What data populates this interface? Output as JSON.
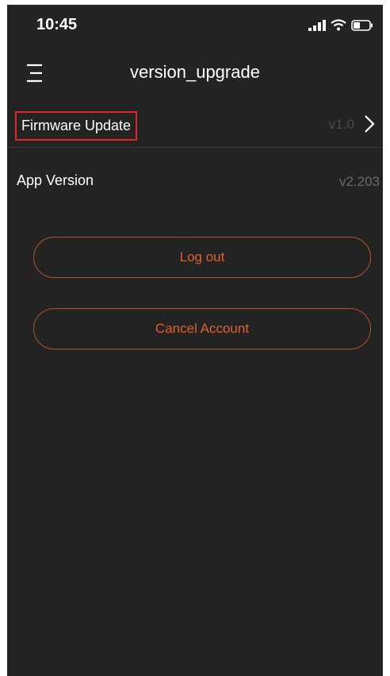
{
  "status_bar": {
    "time": "10:45",
    "icons": [
      "signal-icon",
      "wifi-icon",
      "battery-icon"
    ]
  },
  "header": {
    "title": "version_upgrade",
    "menu_icon": "menu-icon"
  },
  "rows": {
    "firmware": {
      "label": "Firmware Update",
      "value": "v1.0",
      "icon": "chevron-right-icon"
    },
    "app_version": {
      "label": "App Version",
      "value": "v2.203"
    }
  },
  "buttons": {
    "logout_label": "Log out",
    "cancel_account_label": "Cancel Account"
  },
  "colors": {
    "background": "#232323",
    "accent": "#e0602e",
    "button_border": "#b3532d",
    "highlight_box": "#e0282c"
  }
}
